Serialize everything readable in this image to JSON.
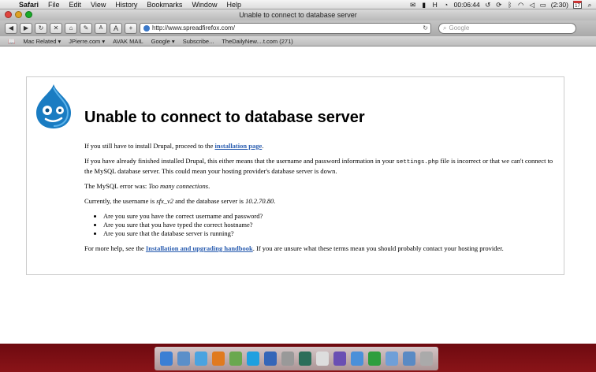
{
  "menubar": {
    "apple": "",
    "items": [
      "Safari",
      "File",
      "Edit",
      "View",
      "History",
      "Bookmarks",
      "Window",
      "Help"
    ],
    "status": {
      "input": "H",
      "time": "00:06:44",
      "battery": "(2:30)",
      "calendar_day": "17"
    }
  },
  "window": {
    "title": "Unable to connect to database server"
  },
  "toolbar": {
    "back_icon": "◀",
    "forward_icon": "▶",
    "reload_icon": "↻",
    "home_icon": "⌂",
    "edit_icon": "✎",
    "font_smaller": "A",
    "font_larger": "A",
    "add": "+",
    "url": "http://www.spreadfirefox.com/",
    "url_reload": "↻",
    "search_placeholder": "Google"
  },
  "bookmarks": {
    "items": [
      "Mac Related ▾",
      "JPierre.com ▾",
      "AVAK MAIL",
      "Google ▾",
      "Subscribe...",
      "TheDailyNew....t.com (271)"
    ]
  },
  "page": {
    "heading": "Unable to connect to database server",
    "install_prefix": "If you still have to install Drupal, proceed to the ",
    "install_link": "installation page",
    "install_suffix": ".",
    "finished_prefix": "If you have already finished installed Drupal, this either means that the username and password information in your ",
    "settings_file": "settings.php",
    "finished_suffix": " file is incorrect or that we can't connect to the MySQL database server. This could mean your hosting provider's database server is down.",
    "mysql_error_prefix": "The MySQL error was: ",
    "mysql_error": "Too many connections",
    "mysql_error_suffix": ".",
    "username_prefix": "Currently, the username is ",
    "username": "sfx_v2",
    "server_prefix": " and the database server is ",
    "server": "10.2.70.80",
    "server_suffix": ".",
    "checks": [
      "Are you sure you have the correct username and password?",
      "Are you sure that you have typed the correct hostname?",
      "Are you sure that the database server is running?"
    ],
    "help_prefix": "For more help, see the ",
    "help_link": "Installation and upgrading handbook",
    "help_suffix": ". If you are unsure what these terms mean you should probably contact your hosting provider."
  },
  "dock": {
    "icons": [
      "finder-icon",
      "preview-icon",
      "safari-icon",
      "firefox-icon",
      "utility-icon",
      "skype-icon",
      "itunes-icon",
      "photo-icon",
      "timemachine-icon",
      "mouse-icon",
      "app-icon",
      "yep-icon",
      "chat-icon",
      "folder-icon",
      "downloads-icon",
      "trash-icon"
    ],
    "colors": [
      "#3b7fd4",
      "#5b8fc9",
      "#4aa3e0",
      "#e07a1f",
      "#6aa84f",
      "#1fa0e0",
      "#3566b8",
      "#999999",
      "#2c6e5a",
      "#dddddd",
      "#6a4fb3",
      "#4a90d9",
      "#2e9e3e",
      "#6f9fd8",
      "#5a8ac4",
      "#aaaaaa"
    ]
  }
}
